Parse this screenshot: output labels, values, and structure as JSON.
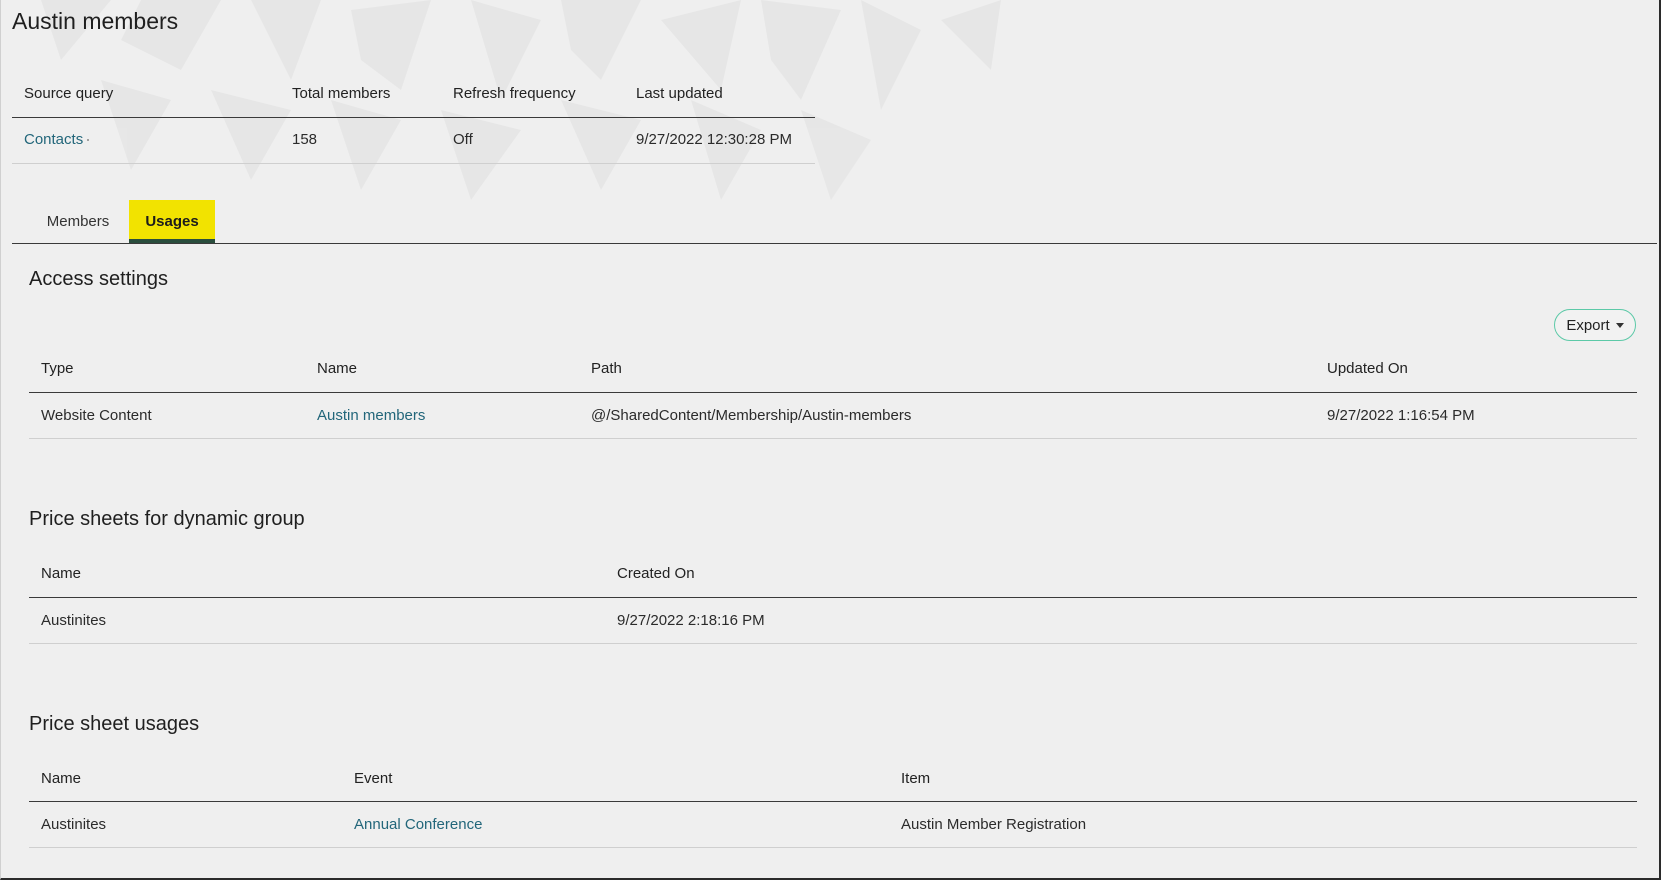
{
  "page": {
    "title": "Austin members"
  },
  "summary": {
    "headers": [
      "Source query",
      "Total members",
      "Refresh frequency",
      "Last updated"
    ],
    "row": {
      "source_query": "Contacts",
      "total_members": "158",
      "refresh_frequency": "Off",
      "last_updated": "9/27/2022 12:30:28 PM"
    }
  },
  "tabs": [
    {
      "label": "Members",
      "active": false
    },
    {
      "label": "Usages",
      "active": true
    }
  ],
  "access_settings": {
    "title": "Access settings",
    "export_label": "Export",
    "headers": [
      "Type",
      "Name",
      "Path",
      "Updated On"
    ],
    "rows": [
      {
        "type": "Website Content",
        "name": "Austin members",
        "path": "@/SharedContent/Membership/Austin-members",
        "updated_on": "9/27/2022 1:16:54 PM"
      }
    ]
  },
  "price_sheets": {
    "title": "Price sheets for dynamic group",
    "headers": [
      "Name",
      "Created On"
    ],
    "rows": [
      {
        "name": "Austinites",
        "created_on": "9/27/2022 2:18:16 PM"
      }
    ]
  },
  "price_sheet_usages": {
    "title": "Price sheet usages",
    "headers": [
      "Name",
      "Event",
      "Item"
    ],
    "rows": [
      {
        "name": "Austinites",
        "event": "Annual Conference",
        "item": "Austin Member Registration"
      }
    ]
  },
  "colors": {
    "link": "#22667a",
    "tab_active_bg": "#f2e300",
    "tab_underline": "#2a4d3d",
    "export_border": "#5cc9a7",
    "background": "#efefef"
  },
  "icons": {
    "export_caret": "caret-down-icon"
  }
}
